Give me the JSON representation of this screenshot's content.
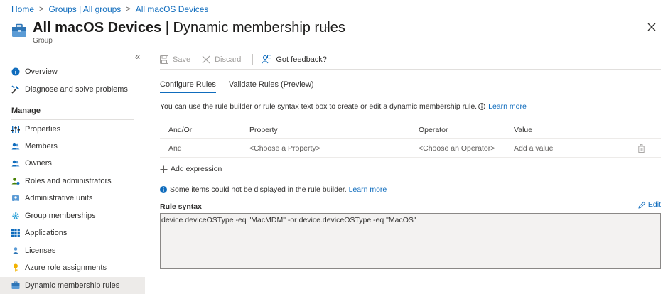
{
  "breadcrumb": [
    "Home",
    "Groups | All groups",
    "All macOS Devices"
  ],
  "header": {
    "title_bold": "All macOS Devices",
    "title_rest": " | Dynamic membership rules",
    "subtitle": "Group",
    "more": "···"
  },
  "sidebar": {
    "collapse": "«",
    "items_top": [
      {
        "label": "Overview",
        "icon": "info-icon"
      },
      {
        "label": "Diagnose and solve problems",
        "icon": "wrench-icon"
      }
    ],
    "section": "Manage",
    "items": [
      {
        "label": "Properties",
        "icon": "sliders-icon"
      },
      {
        "label": "Members",
        "icon": "users-icon"
      },
      {
        "label": "Owners",
        "icon": "users-icon"
      },
      {
        "label": "Roles and administrators",
        "icon": "user-role-icon"
      },
      {
        "label": "Administrative units",
        "icon": "admin-units-icon"
      },
      {
        "label": "Group memberships",
        "icon": "gear-icon"
      },
      {
        "label": "Applications",
        "icon": "grid-icon"
      },
      {
        "label": "Licenses",
        "icon": "license-icon"
      },
      {
        "label": "Azure role assignments",
        "icon": "key-icon"
      },
      {
        "label": "Dynamic membership rules",
        "icon": "briefcase-icon"
      }
    ],
    "active": "Dynamic membership rules"
  },
  "toolbar": {
    "save": "Save",
    "discard": "Discard",
    "feedback": "Got feedback?"
  },
  "tabs": [
    "Configure Rules",
    "Validate Rules (Preview)"
  ],
  "description": {
    "text": "You can use the rule builder or rule syntax text box to create or edit a dynamic membership rule.",
    "link": "Learn more"
  },
  "table": {
    "headers": [
      "And/Or",
      "Property",
      "Operator",
      "Value"
    ],
    "rows": [
      {
        "andor": "And",
        "property": "<Choose a Property>",
        "operator": "<Choose an Operator>",
        "value": "Add a value"
      }
    ]
  },
  "add_expression": "Add expression",
  "notice": {
    "text": "Some items could not be displayed in the rule builder.",
    "link": "Learn more"
  },
  "rule_syntax": {
    "label": "Rule syntax",
    "edit": "Edit",
    "value": "device.deviceOSType -eq \"MacMDM\" -or device.deviceOSType -eq \"MacOS\""
  },
  "colors": {
    "accent": "#0f6cbd",
    "active_bg": "#edebe9",
    "syntax_bg": "#f3f2f1"
  }
}
